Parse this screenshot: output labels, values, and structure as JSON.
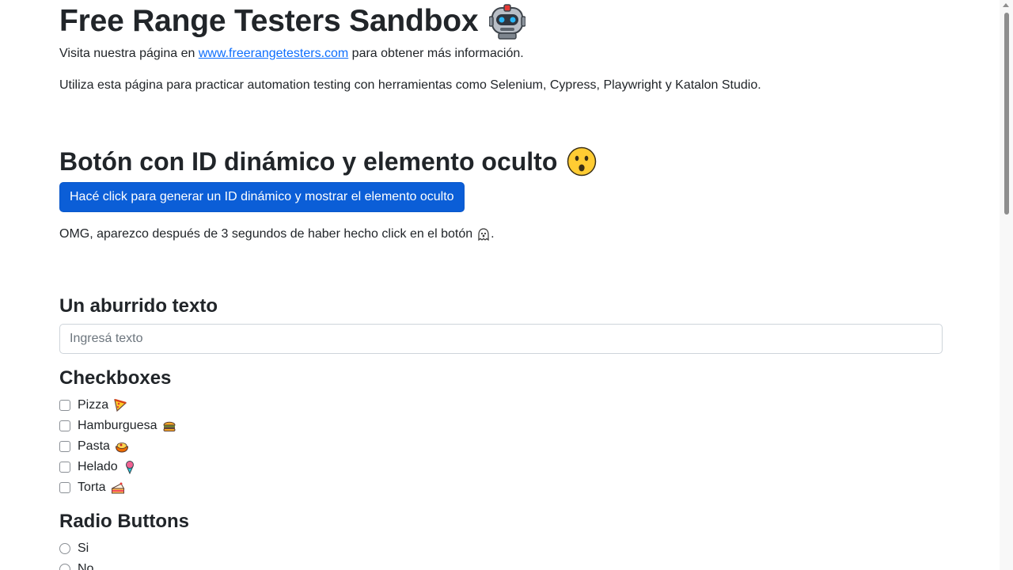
{
  "header": {
    "title": "Free Range Testers Sandbox",
    "title_icon": "robot-icon"
  },
  "intro": {
    "visit_prefix": "Visita nuestra página en ",
    "visit_link": "www.freerangetesters.com",
    "visit_suffix": " para obtener más información.",
    "description": "Utiliza esta página para practicar automation testing con herramientas como Selenium, Cypress, Playwright y Katalon Studio."
  },
  "dynamic_section": {
    "heading": "Botón con ID dinámico y elemento oculto",
    "heading_icon": "surprised-face-icon",
    "button_label": "Hacé click para generar un ID dinámico y mostrar el elemento oculto",
    "hidden_text": "OMG, aparezco después de 3 segundos de haber hecho click en el botón",
    "hidden_text_icon": "ghost-icon",
    "hidden_text_end": "."
  },
  "text_section": {
    "heading": "Un aburrido texto",
    "input_placeholder": "Ingresá texto",
    "input_value": ""
  },
  "checkbox_section": {
    "heading": "Checkboxes",
    "items": [
      {
        "label": "Pizza",
        "icon": "pizza-icon",
        "checked": false
      },
      {
        "label": "Hamburguesa",
        "icon": "hamburger-icon",
        "checked": false
      },
      {
        "label": "Pasta",
        "icon": "pasta-icon",
        "checked": false
      },
      {
        "label": "Helado",
        "icon": "ice-cream-icon",
        "checked": false
      },
      {
        "label": "Torta",
        "icon": "cake-icon",
        "checked": false
      }
    ]
  },
  "radio_section": {
    "heading": "Radio Buttons",
    "items": [
      {
        "label": "Si",
        "checked": false
      },
      {
        "label": "No",
        "checked": false
      }
    ]
  },
  "colors": {
    "primary_button": "#0b5ed7",
    "link": "#0d6efd",
    "text": "#212529"
  }
}
